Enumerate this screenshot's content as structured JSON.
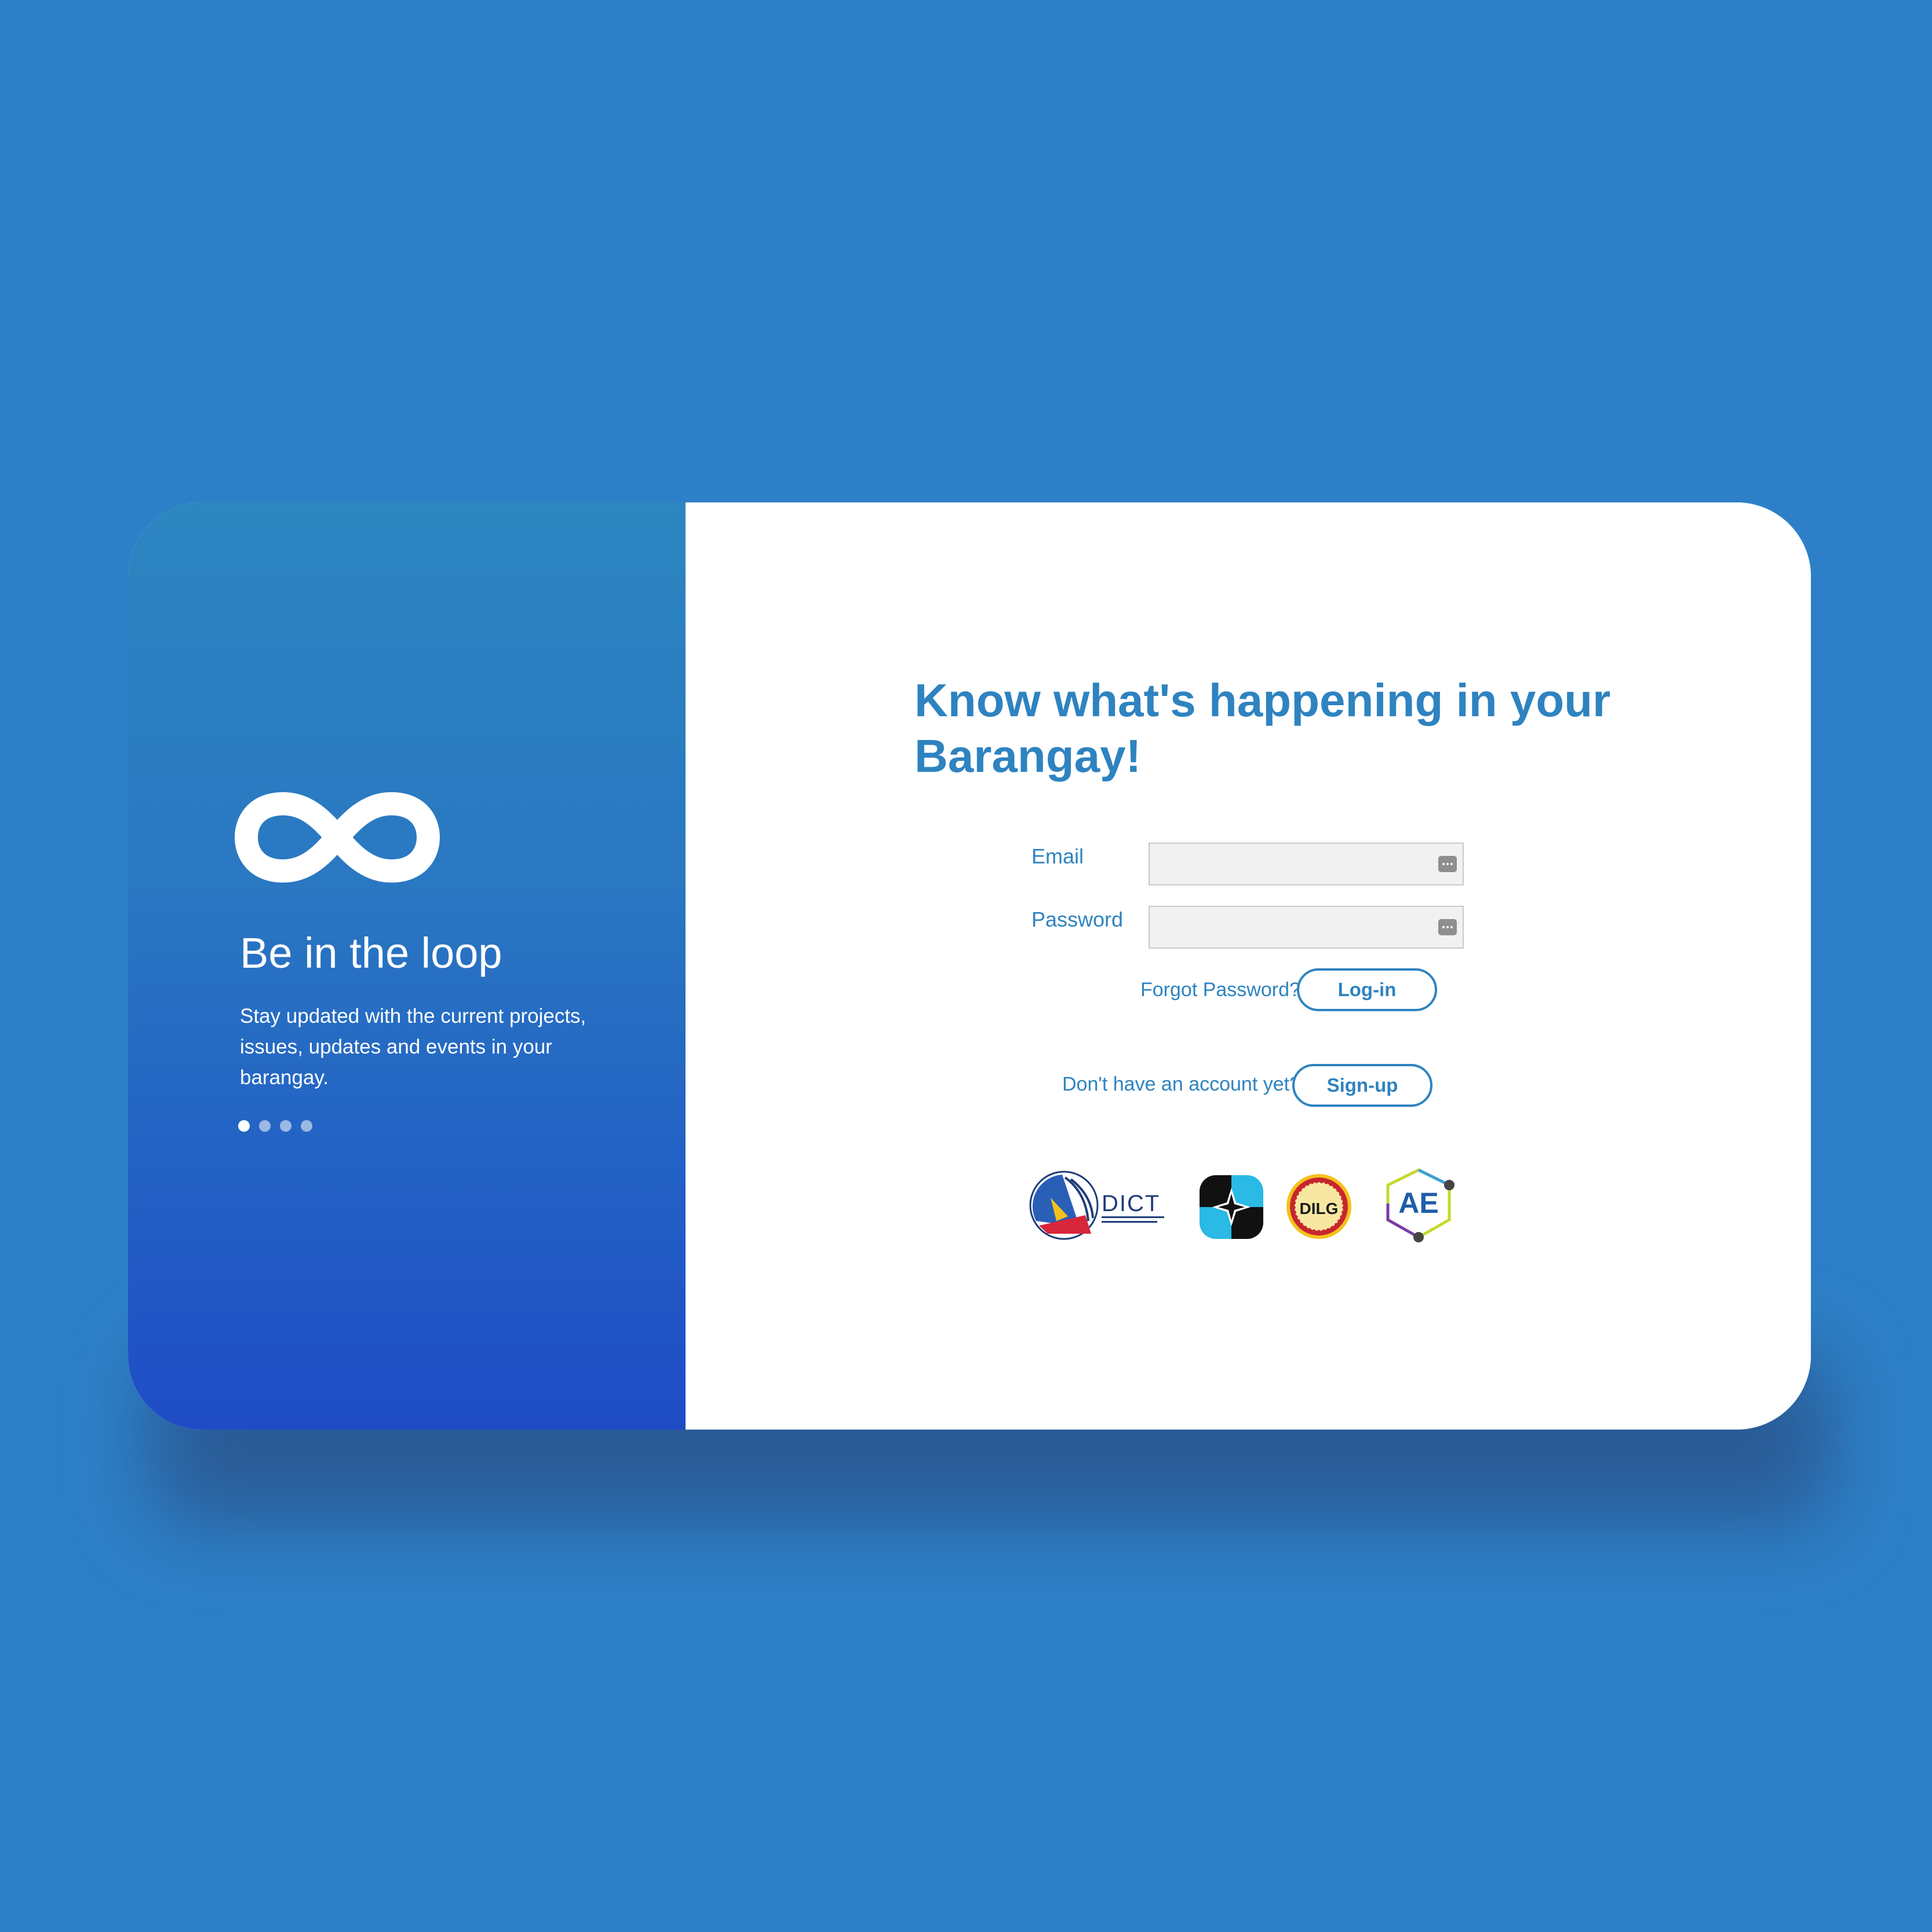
{
  "hero": {
    "title": "Be in the loop",
    "description": "Stay updated with the current projects, issues, updates and events in your barangay.",
    "carousel_dots": 4,
    "active_dot": 1
  },
  "login": {
    "headline": "Know what's happening in your Barangay!",
    "email_label": "Email",
    "email_value": "",
    "password_label": "Password",
    "password_value": "",
    "forgot_password": "Forgot Password?",
    "login_button": "Log-in",
    "signup_prompt": "Don't have an account yet?",
    "signup_button": "Sign-up"
  },
  "partner_logos": [
    {
      "name": "DICT",
      "icon": "dict-seal-logo"
    },
    {
      "name": "",
      "icon": "star-quad-logo"
    },
    {
      "name": "DILG",
      "icon": "dilg-seal-logo"
    },
    {
      "name": "AE",
      "icon": "ae-hexagon-logo"
    }
  ],
  "colors": {
    "page_background": "#2d80c8",
    "accent": "#2e83c0",
    "gradient_top": "#2c86c0",
    "gradient_bottom": "#1f4cc6"
  }
}
